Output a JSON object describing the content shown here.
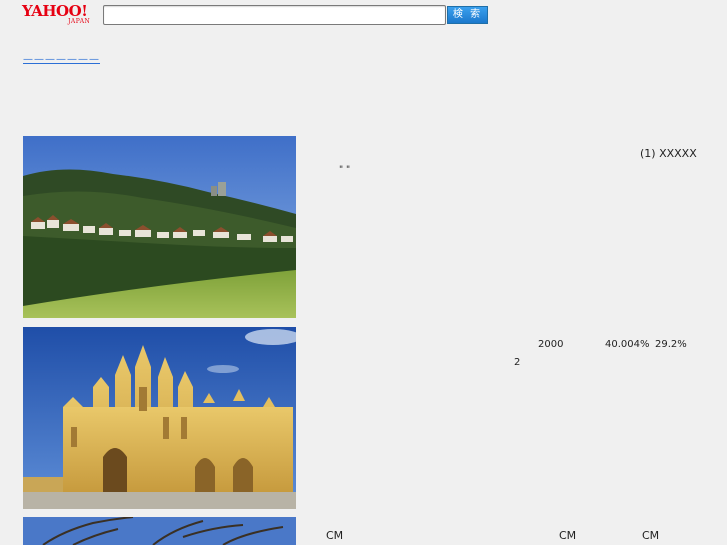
{
  "header": {
    "logo_text": "YAHOO!",
    "logo_sub": "JAPAN",
    "search_placeholder": "",
    "search_value": "",
    "search_button": "検 索"
  },
  "nav": {
    "link": "———————"
  },
  "rows": [
    {
      "texts": {
        "a": "(1) XXXXX",
        "b": "\" \""
      }
    },
    {
      "texts": {
        "a": "2000",
        "b": "40.004%",
        "c": "29.2%",
        "d": "2"
      }
    },
    {
      "texts": {
        "a": "CM",
        "b": "CM",
        "c": "CM"
      }
    }
  ]
}
